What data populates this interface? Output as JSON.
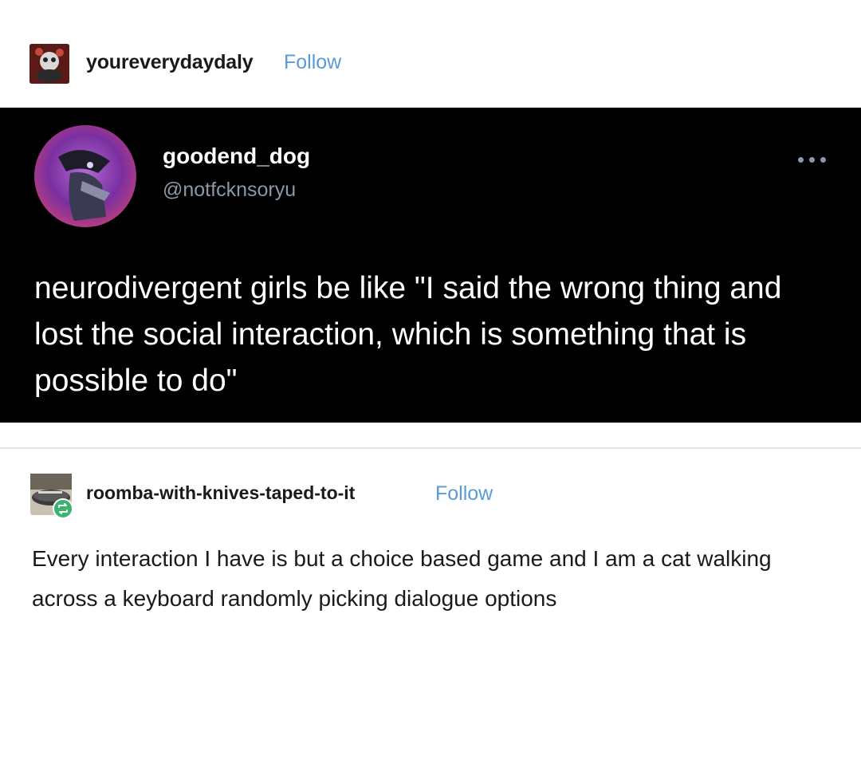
{
  "reblog_header": {
    "username": "youreverydaydaly",
    "follow_label": "Follow",
    "avatar_icon": "user-avatar-icon"
  },
  "tweet": {
    "display_name": "goodend_dog",
    "handle": "@notfcknsoryu",
    "more_icon": "more-options-icon",
    "text": "neurodivergent girls be like \"I said the wrong thing and lost the social interaction, which is something that is possible to do\""
  },
  "reblog_comment": {
    "username": "roomba-with-knives-taped-to-it",
    "follow_label": "Follow",
    "text": "Every interaction I have is but a choice based game and I am a cat walking across a keyboard randomly picking dialogue options",
    "badge_icon": "reblog-icon"
  },
  "colors": {
    "follow_link": "#5a9ad8",
    "tweet_background": "#000000",
    "tweet_handle": "#8b98a5",
    "reblog_badge": "#3cb371"
  }
}
